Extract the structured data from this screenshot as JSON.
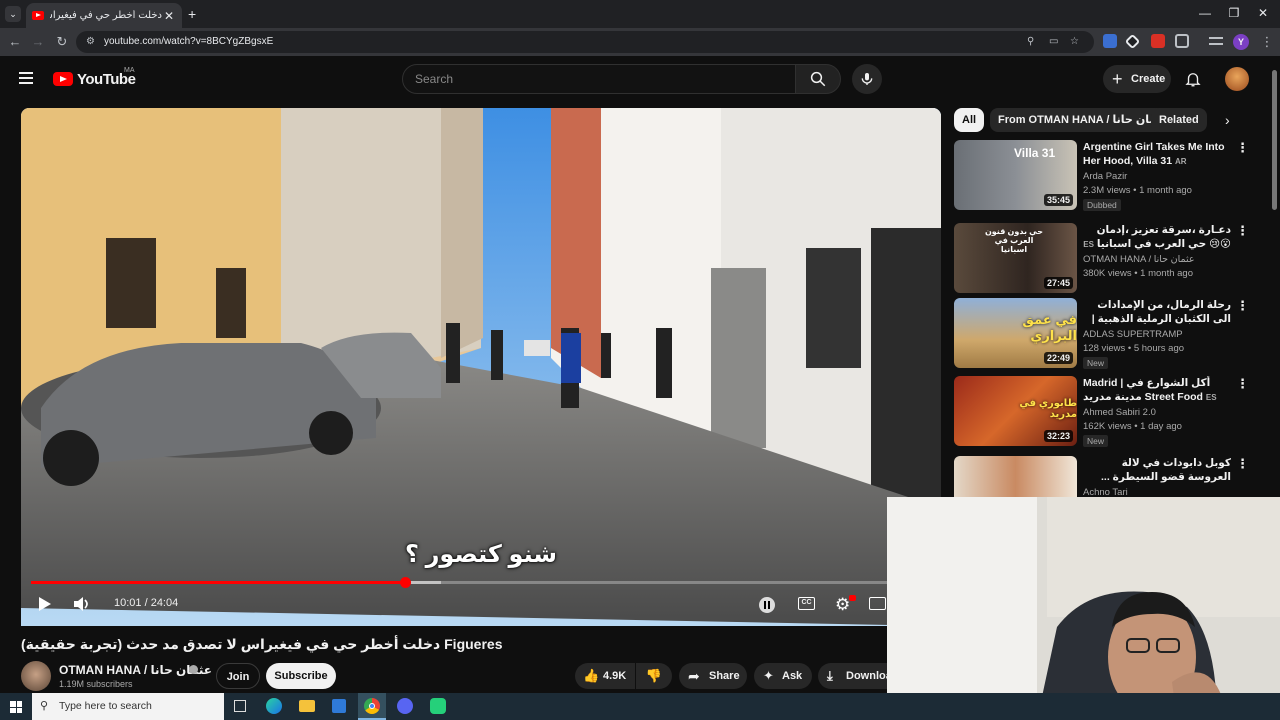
{
  "browser": {
    "tab_title": "دخلت أخطر حي في فيغيراس لا ت...",
    "url": "youtube.com/watch?v=8BCYgZBgsxE",
    "profile_initial": "Y"
  },
  "header": {
    "logo_text": "YouTube",
    "country_code": "MA",
    "search_placeholder": "Search",
    "create_label": "Create"
  },
  "player": {
    "subtitle": "شنو كتصور ؟",
    "time": "10:01 / 24:04",
    "progress": 0.416,
    "buffered": 0.455
  },
  "video": {
    "title": "دخلت أخطر حي في فيغيراس لا تصدق مد حدث (تجربة حقيقية) Figueres",
    "channel": "OTMAN HANA / عثمان حانا",
    "subscribers": "1.19M subscribers",
    "join_label": "Join",
    "subscribe_label": "Subscribe",
    "likes": "4.9K",
    "share_label": "Share",
    "ask_label": "Ask",
    "download_label": "Download"
  },
  "chips": [
    "All",
    "From OTMAN HANA / عثمان حانا",
    "Related"
  ],
  "recommendations": [
    {
      "title": "Argentine Girl Takes Me Into Her Hood, Villa 31",
      "tag": "AR",
      "channel": "Arda Pazir",
      "meta": "2.3M views • 1 month ago",
      "duration": "35:45",
      "badge": "Dubbed",
      "thumb_text": "Villa 31"
    },
    {
      "title": "دعـارة ،سرقة تعزيز ،إدمان 😮😢 حي العرب في اسبانيا",
      "tag": "ES",
      "channel": "OTMAN HANA / عثمان حانا",
      "meta": "380K views • 1 month ago",
      "duration": "27:45",
      "badge": "",
      "thumb_text": "حي بدون قنون العرب في اسبانيا"
    },
    {
      "title": "رحلة الرمال، من الإمدادات الى الكثبان الرملية الذهبية | بالدراجة الهوائية 🚵",
      "tag": "",
      "channel": "ADLAS SUPERTRAMP",
      "meta": "128 views • 5 hours ago",
      "duration": "22:49",
      "badge": "New",
      "thumb_text": "في عمق البراري"
    },
    {
      "title": "Madrid | أكل الشوارع في مدينة مدريد Street Food",
      "tag": "ES",
      "channel": "Ahmed Sabiri 2.0",
      "meta": "162K views • 1 day ago",
      "duration": "32:23",
      "badge": "New",
      "thumb_text": "طابوري في مدريد"
    },
    {
      "title": "كوبل دابودات في لالة العروسة قضو السيطرة ... ملي عطاوهم مسؤولية الدار ومتخيلش أشنو",
      "tag": "",
      "channel": "Achno Tari",
      "meta": "",
      "duration": "",
      "badge": "",
      "thumb_text": ""
    }
  ],
  "taskbar": {
    "search_placeholder": "Type here to search"
  },
  "colors": {
    "accent": "#ff0000",
    "background": "#0f0f0f"
  }
}
